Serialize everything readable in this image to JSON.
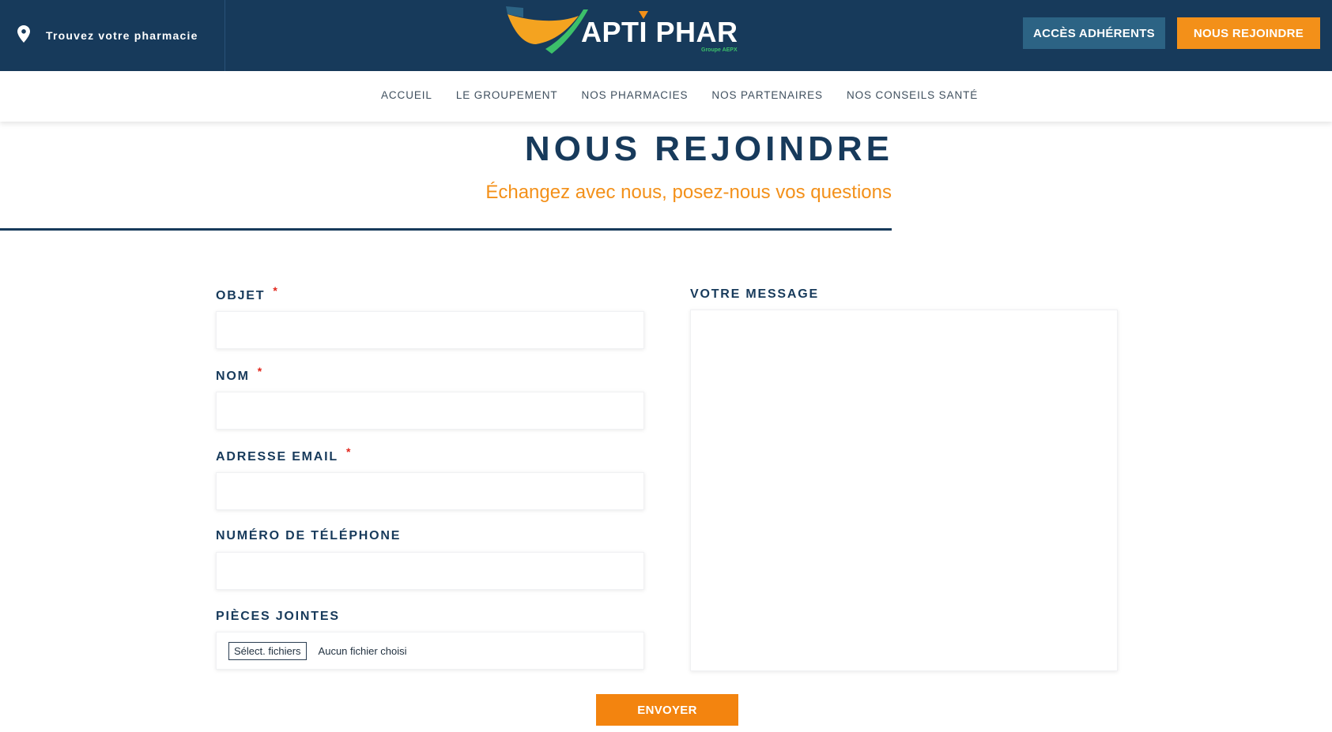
{
  "header": {
    "finder_label": "Trouvez votre pharmacie",
    "logo_text": "APTI PHAR",
    "logo_sub": "Groupe AEPX",
    "member_button": "ACCÈS ADHÉRENTS",
    "join_button": "NOUS REJOINDRE",
    "colors": {
      "header_bg": "#173a5b",
      "accent": "#f39019",
      "member_bg": "#2c6384",
      "logo_green": "#3cc06a"
    }
  },
  "nav": {
    "items": [
      {
        "label": "ACCUEIL"
      },
      {
        "label": "LE GROUPEMENT"
      },
      {
        "label": "NOS PHARMACIES"
      },
      {
        "label": "NOS PARTENAIRES"
      },
      {
        "label": "NOS CONSEILS SANTÉ"
      }
    ]
  },
  "page": {
    "title": "NOUS REJOINDRE",
    "subtitle": "Échangez avec nous, posez-nous vos questions"
  },
  "form": {
    "required_marker": "*",
    "objet_label": "OBJET",
    "objet_value": "",
    "nom_label": "NOM",
    "nom_value": "",
    "email_label": "ADRESSE EMAIL",
    "email_value": "",
    "phone_label": "NUMÉRO DE TÉLÉPHONE",
    "phone_value": "",
    "attachments_label": "PIÈCES JOINTES",
    "file_button": "Sélect. fichiers",
    "file_status": "Aucun fichier choisi",
    "message_label": "VOTRE MESSAGE",
    "message_value": "",
    "submit": "ENVOYER"
  },
  "icons": {
    "finder": "location-pin-icon",
    "logo": "aptiphar-logo"
  }
}
